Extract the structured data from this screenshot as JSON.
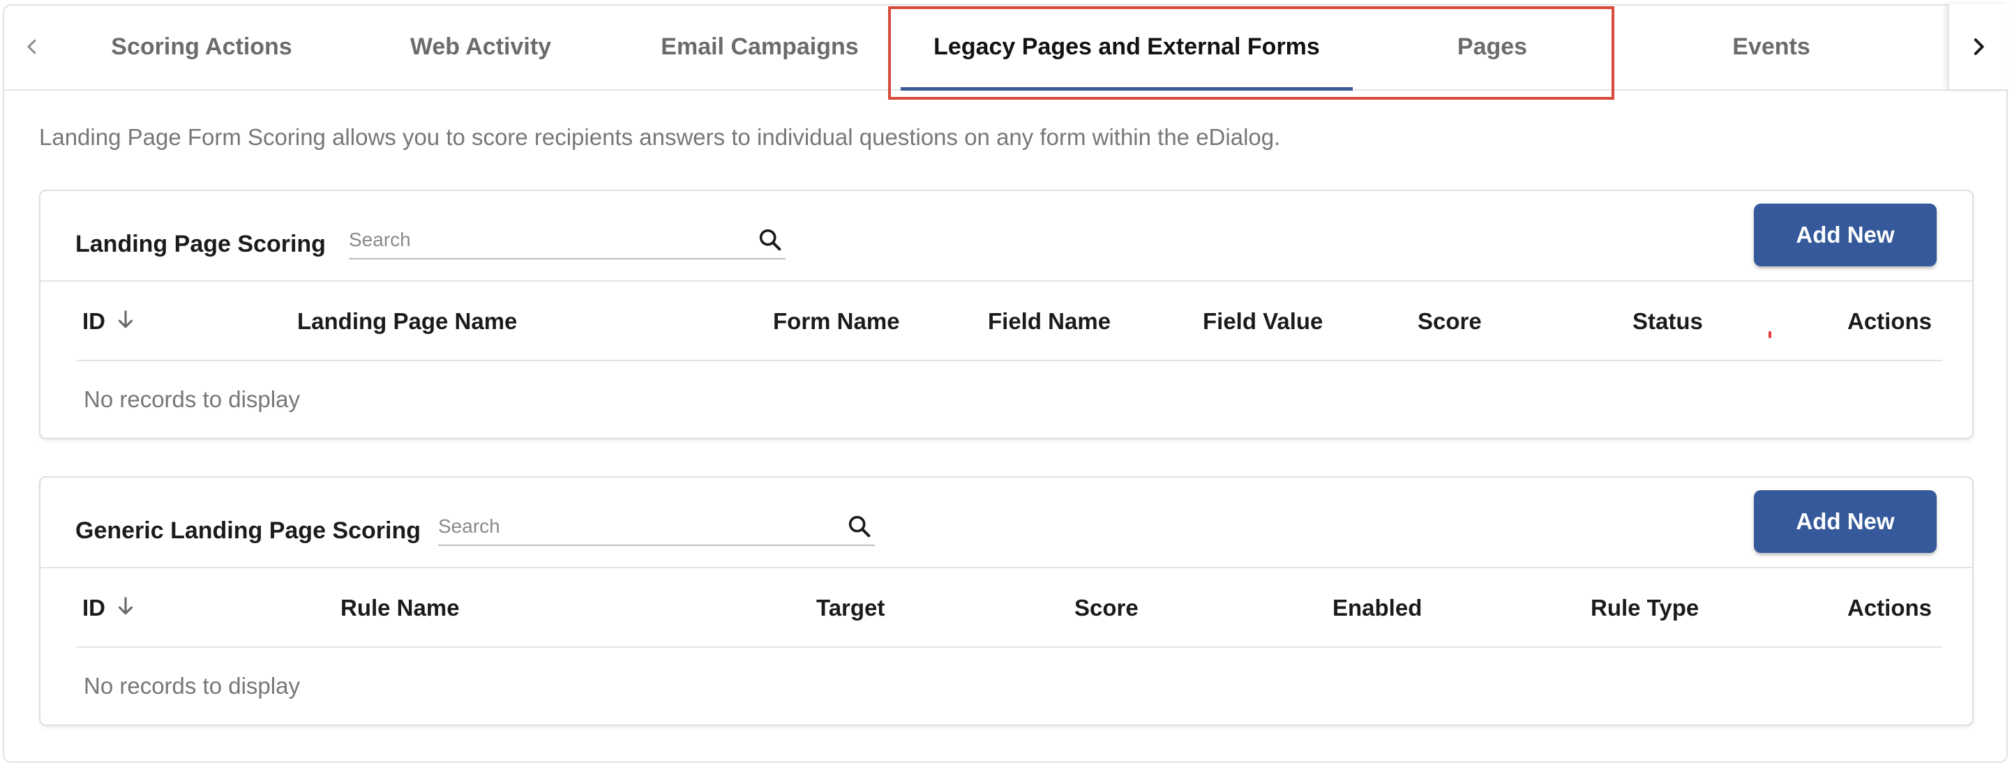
{
  "tabs": [
    {
      "label": "Scoring Actions",
      "active": false
    },
    {
      "label": "Web Activity",
      "active": false
    },
    {
      "label": "Email Campaigns",
      "active": false
    },
    {
      "label": "Legacy Pages and External Forms",
      "active": true
    },
    {
      "label": "Pages",
      "active": false
    },
    {
      "label": "Events",
      "active": false
    }
  ],
  "description": "Landing Page Form Scoring allows you to score recipients answers to individual questions on any form within the eDialog.",
  "landing": {
    "title": "Landing Page Scoring",
    "search_placeholder": "Search",
    "add_label": "Add New",
    "columns": [
      "ID",
      "Landing Page Name",
      "Form Name",
      "Field Name",
      "Field Value",
      "Score",
      "Status",
      "Actions"
    ],
    "empty_text": "No records to display"
  },
  "generic": {
    "title": "Generic Landing Page Scoring",
    "search_placeholder": "Search",
    "add_label": "Add New",
    "columns": [
      "ID",
      "Rule Name",
      "Target",
      "Score",
      "Enabled",
      "Rule Type",
      "Actions"
    ],
    "empty_text": "No records to display"
  },
  "colors": {
    "accent": "#35599a",
    "tab_underline": "#3a5a9a",
    "highlight": "#d64b3a"
  },
  "icons": {
    "tab_prev": "chevron-left-icon",
    "tab_next": "chevron-right-icon",
    "search": "search-icon",
    "sort": "arrow-down-icon"
  }
}
